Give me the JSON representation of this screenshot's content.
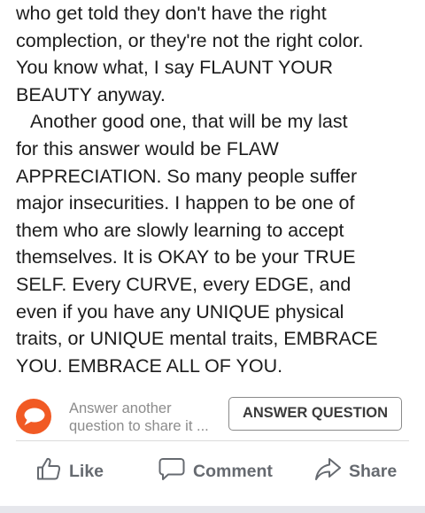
{
  "post": {
    "lines": [
      "who get told they don't have the right",
      "complection, or they're not the right color.",
      "You know what, I say FLAUNT YOUR",
      "BEAUTY anyway.",
      "Another good one, that will be my last",
      "for this answer would be FLAW",
      "APPRECIATION. So many people suffer",
      "major insecurities. I happen to be one of",
      "them who are slowly learning to accept",
      "themselves. It is OKAY to be your TRUE",
      "SELF. Every CURVE, every EDGE, and",
      "even if you have any UNIQUE physical",
      "traits, or UNIQUE mental traits, EMBRACE",
      "YOU. EMBRACE ALL OF YOU."
    ]
  },
  "share_prompt": {
    "line1": "Answer another",
    "line2": "question to share it ...",
    "button_label": "ANSWER QUESTION",
    "avatar_icon": "speech-bubble-icon",
    "avatar_color": "#f15a24"
  },
  "actions": {
    "like": {
      "label": "Like",
      "icon": "thumbs-up-icon"
    },
    "comment": {
      "label": "Comment",
      "icon": "comment-bubble-icon"
    },
    "share": {
      "label": "Share",
      "icon": "share-arrow-icon"
    }
  }
}
